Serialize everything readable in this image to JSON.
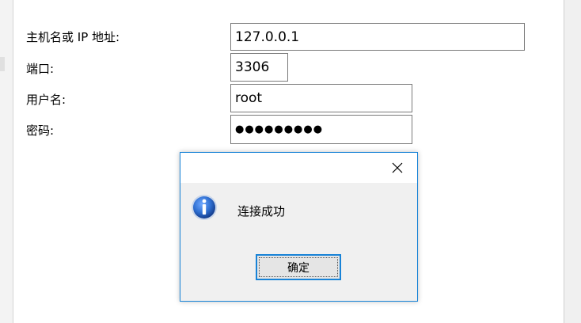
{
  "form": {
    "host": {
      "label": "主机名或 IP 地址:",
      "value": "127.0.0.1"
    },
    "port": {
      "label": "端口:",
      "value": "3306"
    },
    "user": {
      "label": "用户名:",
      "value": "root"
    },
    "password": {
      "label": "密码:",
      "value": "●●●●●●●●●"
    }
  },
  "dialog": {
    "message": "连接成功",
    "ok_label": "确定",
    "icon": "info-icon",
    "close_icon": "close-icon"
  },
  "colors": {
    "dialog_border": "#1883d7",
    "dialog_body": "#f0f0f0",
    "button_focus_border": "#1883d7",
    "info_icon_blue": "#1f5fbf"
  }
}
